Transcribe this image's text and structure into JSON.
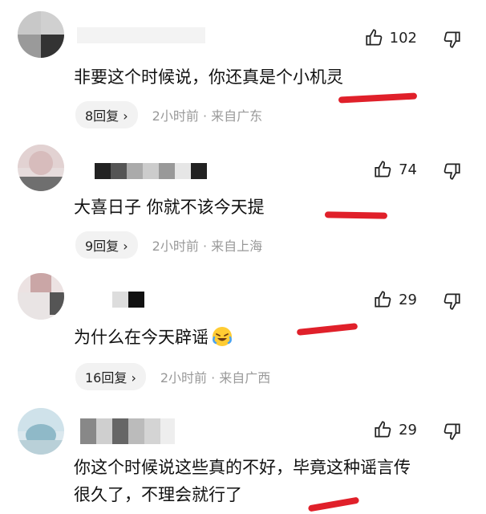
{
  "comments": [
    {
      "text": "非要这个时候说，你还真是个小机灵",
      "likes": "102",
      "reply_label": "8回复 ›",
      "meta": "2小时前 · 来自广东"
    },
    {
      "text": "大喜日子 你就不该今天提",
      "likes": "74",
      "reply_label": "9回复 ›",
      "meta": "2小时前 · 来自上海"
    },
    {
      "text": "为什么在今天辟谣",
      "likes": "29",
      "reply_label": "16回复 ›",
      "meta": "2小时前 · 来自广西"
    },
    {
      "text": "你这个时候说这些真的不好，毕竟这种谣言传",
      "text_line2": "很久了，不理会就行了",
      "likes": "29"
    }
  ],
  "icons": {
    "like": "thumbs-up-icon",
    "dislike": "thumbs-down-icon",
    "emoji": "crying-laugh-emoji"
  },
  "colors": {
    "annotation": "#e0202a",
    "meta": "#999999"
  }
}
